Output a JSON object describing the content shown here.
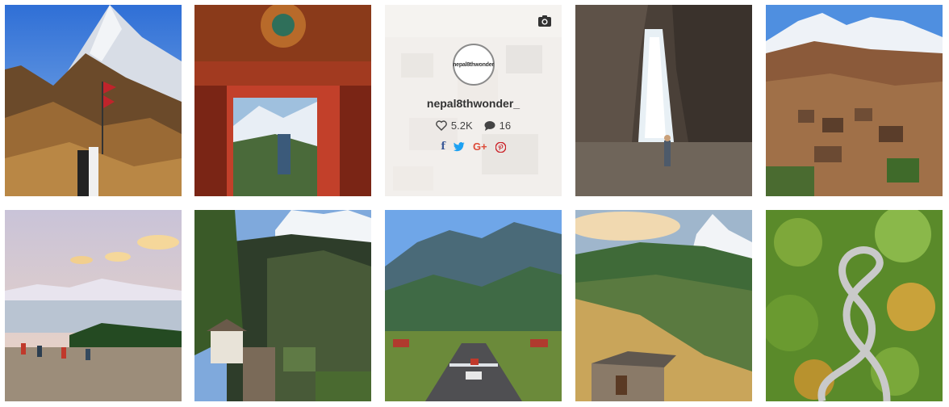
{
  "profile": {
    "username": "nepal8thwonder_",
    "avatar_text": "nepal8thwonder",
    "likes": "5.2K",
    "comments": "16"
  },
  "icons": {
    "camera": "camera-icon",
    "heart": "heart-icon",
    "comment": "comment-icon"
  },
  "share": {
    "facebook": "f",
    "twitter": "twitter-bird",
    "google_plus": "G+",
    "pinterest": "pinterest-p"
  },
  "colors": {
    "facebook": "#3b5998",
    "twitter": "#1da1f2",
    "google_plus": "#dd4b39",
    "pinterest": "#cb2027",
    "overlay_text": "#333333"
  }
}
